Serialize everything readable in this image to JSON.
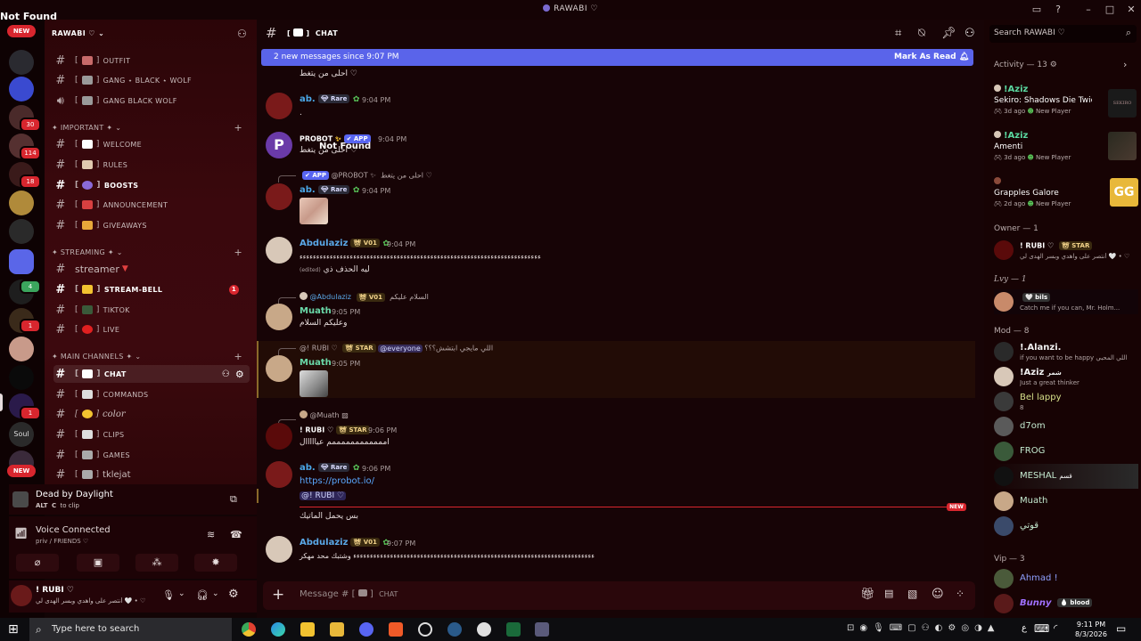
{
  "window": {
    "title": "RAWABI ♡",
    "corner_text": "Not Found"
  },
  "servers": {
    "new_top": "NEW",
    "new_bottom": "NEW",
    "badges": [
      "30",
      "114",
      "18",
      "4",
      "1",
      "1"
    ],
    "soul_label": "Soul"
  },
  "sidebar": {
    "server_name": "RAWABI ♡",
    "channels_top": [
      {
        "bracket": "[",
        "label": "OUTFIT",
        "color": "#c86a6a"
      },
      {
        "bracket": "[",
        "label": "GANG ⋆ BLACK ⋆ WOLF",
        "color": "#9a9a9a"
      },
      {
        "bracket": "",
        "label": "GANG BLACK WOLF",
        "color": "#9a9a9a"
      }
    ],
    "cat_important": "✦ IMPORTANT ✦",
    "important": [
      {
        "label": "WELCOME",
        "color": "#ffffff"
      },
      {
        "label": "RULES",
        "color": "#e0c9b0"
      },
      {
        "label": "BOOSTS",
        "color": "#8a6ad8",
        "bold": true
      },
      {
        "label": "ANNOUNCEMENT",
        "color": "#d84040"
      },
      {
        "label": "GIVEAWAYS",
        "color": "#e8a83a"
      }
    ],
    "cat_streaming": "✦ STREAMING ✦",
    "streamer": "streamer",
    "streaming": [
      {
        "label": "STREAM-BELL",
        "color": "#f2c230",
        "bold": true,
        "unread": "1"
      },
      {
        "label": "TIKTOK",
        "color": "#3a5a3a"
      },
      {
        "label": "LIVE",
        "color": "#e02020"
      }
    ],
    "cat_main": "✦ MAIN CHANNELS ✦",
    "main": [
      {
        "label": "CHAT",
        "color": "#ffffff"
      },
      {
        "label": "COMMANDS",
        "color": "#dddddd"
      },
      {
        "label": "color",
        "color": "#f2c230"
      },
      {
        "label": "CLIPS",
        "color": "#dddddd"
      },
      {
        "label": "GAMES",
        "color": "#aaaaaa"
      },
      {
        "label": "tklejat",
        "color": "#aaaaaa"
      }
    ]
  },
  "game": {
    "title": "Dead by Daylight",
    "key1": "ALT",
    "key2": "C",
    "hint": "to clip"
  },
  "voice": {
    "status": "Voice Connected",
    "channel": "priv / FRIENDS ♡"
  },
  "user": {
    "name": "! RUBI ♡",
    "status": "أنتصر على واهدي وبسر الهدى لي 🤍 • ♡"
  },
  "chat": {
    "channel_label": "CHAT",
    "new_messages": "2 new messages since 9:07 PM",
    "mark_read": "Mark As Read",
    "input_placeholder": "Message #",
    "input_channel": "CHAT",
    "new_divider": "NEW",
    "notfound_overlay": "Not Found",
    "messages": {
      "m0_text": "احلى من يتغط ♡",
      "m1_name": "ab.",
      "m1_tag": "Rare",
      "m1_time": "9:04 PM",
      "m1_text": ".",
      "m2_name": "PROBOT",
      "m2_app": "APP",
      "m2_time": "9:04 PM",
      "m2_text": "احلى من يتغط ♡",
      "r3_app": "APP",
      "r3_name": "@PROBOT",
      "r3_text": "احلى من يتغط ♡",
      "m3_name": "ab.",
      "m3_tag": "Rare",
      "m3_time": "9:04 PM",
      "m4_name": "Abdulaziz",
      "m4_tag": "V01",
      "m4_time": "9:04 PM",
      "m4_text": "ءءءءءءءءءءءءءءءءءءءءءءءءءءءءءءءءءءءءءءءءءءءءءءءءءءءءءءءءءءءءءءءءءءءءءءءء",
      "m4_edit": "(edited)",
      "m4_text2": "ليه الحذف ذي",
      "r5_name": "@Abdulaziz",
      "r5_tag": "V01",
      "r5_text": "السلام عليكم",
      "m5_name": "Muath",
      "m5_time": "9:05 PM",
      "m5_text": "وعليكم السلام",
      "r6_name": "@! RUBI ♡",
      "r6_tag": "STAR",
      "r6_mention": "@everyone",
      "r6_text": "اللي مايجي ابتشش؟؟؟",
      "m6_name": "Muath",
      "m6_time": "9:05 PM",
      "r7_name": "@Muath",
      "m7_name": "! RUBI ♡",
      "m7_tag": "STAR",
      "m7_time": "9:06 PM",
      "m7_text": "اممممممممممممم عيااااال",
      "m8_name": "ab.",
      "m8_tag": "Rare",
      "m8_time": "9:06 PM",
      "m8_link": "https://probot.io/",
      "m8_mention": "@! RUBI ♡",
      "m8_text": "بس يحمل الماتيك",
      "m9_name": "Abdulaziz",
      "m9_tag": "V01",
      "m9_time": "9:07 PM",
      "m9_text": "ءءءءءءءءءءءءءءءءءءءءءءءءءءءءءءءءءءءءءءءءءءءءءءءءءءءءءءءءءءءءءءءءءءءءءءءء وشتبك محد مهكر"
    }
  },
  "search": {
    "placeholder": "Search RAWABI ♡"
  },
  "members": {
    "activity_header": "Activity — 13",
    "activities": [
      {
        "name": "!Aziz",
        "game": "Sekiro: Shadows Die Twice ...",
        "meta": "3d ago",
        "tag": "New Player",
        "thumb": "SEKIRO"
      },
      {
        "name": "!Aziz",
        "game": "Amenti",
        "meta": "3d ago",
        "tag": "New Player",
        "thumb": ""
      },
      {
        "name": "",
        "game": "Grapples Galore",
        "meta": "2d ago",
        "tag": "New Player",
        "thumb": "GG"
      }
    ],
    "owner_header": "Owner — 1",
    "owner": {
      "name": "! RUBI ♡",
      "tag": "STAR",
      "status": "أنتصر على واهدي وبسر الهدى لي 🤍 • ♡"
    },
    "lvy_header": "Lvy — 1",
    "lvy": {
      "name": "",
      "tag": "bils",
      "status": "Catch me if you can, Mr. Holm..."
    },
    "mod_header": "Mod — 8",
    "mods": [
      {
        "name": "!.Alanzi.",
        "status": "if you want to be happy اللي المحبي",
        "color": "#f2f2f2"
      },
      {
        "name": "!Aziz",
        "status": "Just a great thinker",
        "color": "#f2f2f2",
        "extra": "شمر"
      },
      {
        "name": "Bel lappy",
        "status": "8",
        "color": "#d6e08a"
      },
      {
        "name": "d7om",
        "status": "",
        "color": "#c5ead0"
      },
      {
        "name": "FROG",
        "status": "",
        "color": "#c5ead0"
      },
      {
        "name": "MESHAL",
        "status": "",
        "color": "#c5ead0",
        "extra": "قسم"
      },
      {
        "name": "Muath",
        "status": "",
        "color": "#c5ead0"
      },
      {
        "name": "قوتي",
        "status": "",
        "color": "#c5ead0"
      }
    ],
    "vip_header": "Vip — 3",
    "vips": [
      {
        "name": "Ahmad !",
        "color": "#8fa0ff"
      },
      {
        "name": "Bunny",
        "color": "#a070ff",
        "extra": "blood"
      }
    ]
  },
  "taskbar": {
    "search": "Type here to search",
    "time": "9:11 PM",
    "date": "8/3/2026",
    "lang": "ع"
  }
}
